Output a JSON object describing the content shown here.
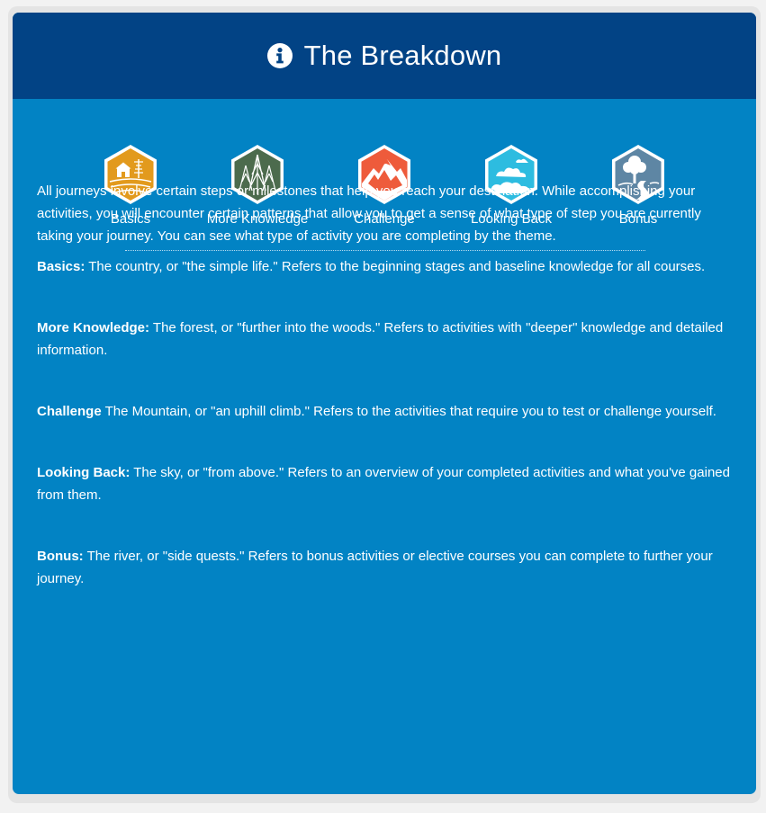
{
  "header": {
    "title": "The Breakdown",
    "icon": "info-circle-icon"
  },
  "themes": [
    {
      "label": "Basics",
      "icon": "farm-icon",
      "color": "#e29a1d"
    },
    {
      "label": "More Knowledge",
      "icon": "forest-icon",
      "color": "#4c6b4d"
    },
    {
      "label": "Challenge",
      "icon": "mountain-icon",
      "color": "#ee5b3b"
    },
    {
      "label": "Looking Back",
      "icon": "sky-icon",
      "color": "#2dbce0"
    },
    {
      "label": "Bonus",
      "icon": "river-icon",
      "color": "#5e86a4"
    }
  ],
  "intro": "All journeys involve certain steps or milestones that help you reach your destination. While accomplishing your activities, you will encounter certain patterns that allow you to get a sense of what type of step you are currently taking your journey. You can see what type of activity you are completing by the theme.",
  "definitions": [
    {
      "term": "Basics:",
      "text": " The country, or \"the simple life.\" Refers to the beginning stages and baseline knowledge for all courses."
    },
    {
      "term": "More Knowledge:",
      "text": " The forest, or \"further into the woods.\" Refers to activities with \"deeper\" knowledge and detailed information."
    },
    {
      "term": "Challenge",
      "text": " The Mountain, or \"an uphill climb.\" Refers to the activities that require you to test or challenge yourself."
    },
    {
      "term": "Looking Back:",
      "text": " The sky, or \"from above.\" Refers to an overview of your completed activities and what you've gained from them."
    },
    {
      "term": "Bonus:",
      "text": " The river, or \"side quests.\" Refers to bonus activities or elective courses you can complete to further your journey."
    }
  ],
  "colors": {
    "header_bg": "#024385",
    "body_bg": "#0283c4",
    "text": "#ffffff"
  }
}
